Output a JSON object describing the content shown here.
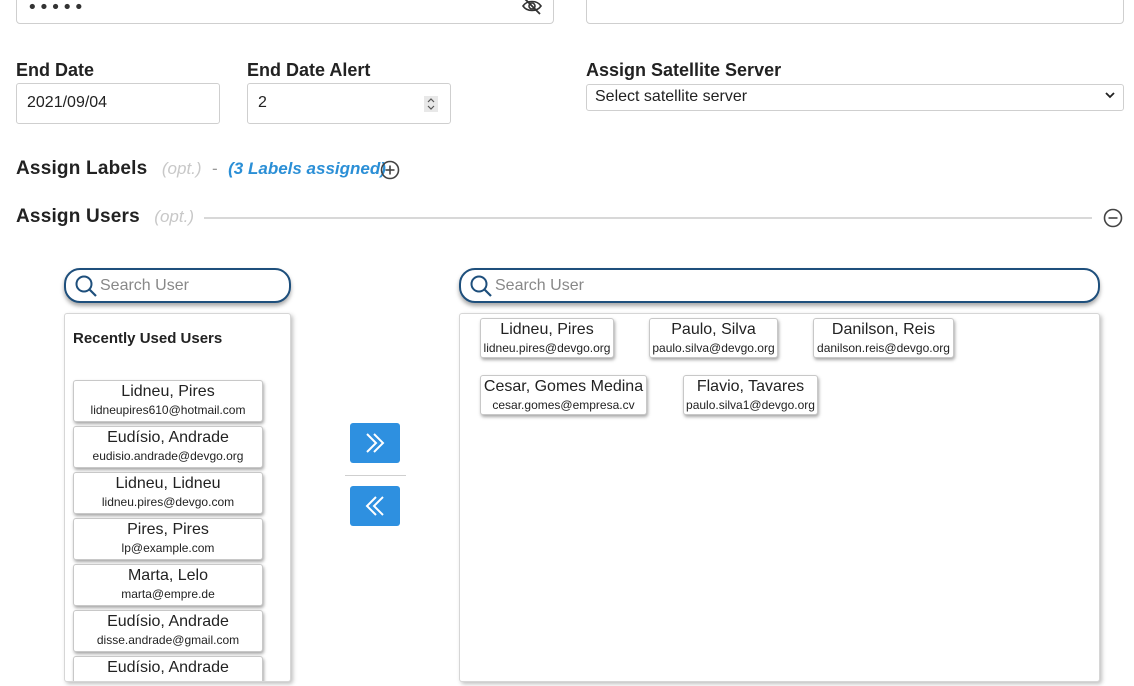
{
  "top": {
    "password_mask": "•••••"
  },
  "end_date": {
    "label": "End Date",
    "value": "2021/09/04"
  },
  "end_date_alert": {
    "label": "End Date Alert",
    "value": "2"
  },
  "satellite": {
    "label": "Assign Satellite Server",
    "selected": "Select satellite server"
  },
  "assign_labels": {
    "title": "Assign Labels",
    "opt": "(opt.)",
    "dash": "-",
    "assigned": "(3 Labels assigned)"
  },
  "assign_users": {
    "title": "Assign Users",
    "opt": "(opt.)"
  },
  "left_search": {
    "placeholder": "Search User"
  },
  "right_search": {
    "placeholder": "Search User"
  },
  "recent": {
    "title": "Recently Used Users",
    "users": [
      {
        "name": "Lidneu, Pires",
        "email": "lidneupires610@hotmail.com"
      },
      {
        "name": "Eudísio, Andrade",
        "email": "eudisio.andrade@devgo.org"
      },
      {
        "name": "Lidneu, Lidneu",
        "email": "lidneu.pires@devgo.com"
      },
      {
        "name": "Pires, Pires",
        "email": "lp@example.com"
      },
      {
        "name": "Marta, Lelo",
        "email": "marta@empre.de"
      },
      {
        "name": "Eudísio, Andrade",
        "email": "disse.andrade@gmail.com"
      },
      {
        "name": "Eudísio, Andrade",
        "email": ""
      }
    ]
  },
  "assigned_users": [
    {
      "name": "Lidneu, Pires",
      "email": "lidneu.pires@devgo.org"
    },
    {
      "name": "Paulo, Silva",
      "email": "paulo.silva@devgo.org"
    },
    {
      "name": "Danilson, Reis",
      "email": "danilson.reis@devgo.org"
    },
    {
      "name": "Cesar, Gomes Medina",
      "email": "cesar.gomes@empresa.cv"
    },
    {
      "name": "Flavio, Tavares",
      "email": "paulo.silva1@devgo.org"
    }
  ],
  "colors": {
    "accent": "#2e90e0",
    "link": "#2b8fd6",
    "search_border": "#1e4f7c"
  },
  "icons": {
    "eye": "eye-slash-icon",
    "add": "plus-circle-icon",
    "collapse": "minus-circle-icon",
    "search": "search-icon",
    "move_right": "double-chevron-right-icon",
    "move_left": "double-chevron-left-icon"
  }
}
